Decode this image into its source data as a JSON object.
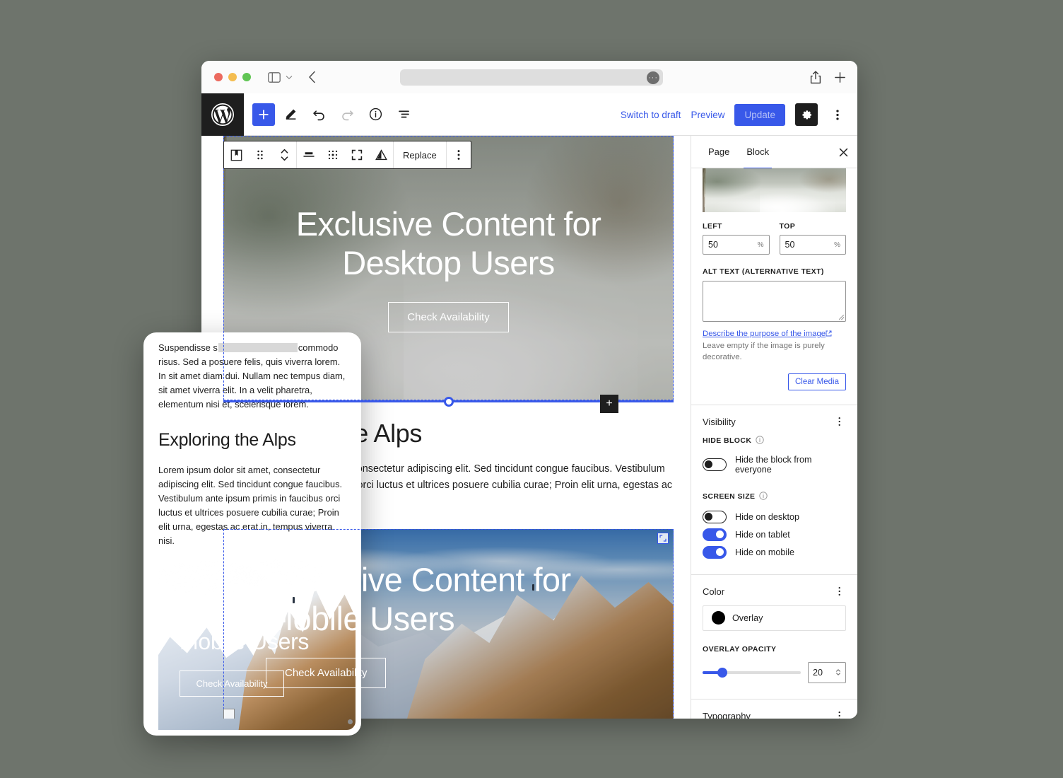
{
  "browser": {
    "traffic_lights": [
      "close",
      "minimize",
      "zoom"
    ],
    "url_value": "",
    "icons": [
      "sidebar-toggle-icon",
      "chevron-down-icon",
      "back-arrow-icon",
      "share-icon",
      "new-tab-icon"
    ]
  },
  "editor_header": {
    "logo": "wordpress-logo",
    "tools": [
      {
        "name": "add-block-button",
        "icon": "plus-icon"
      },
      {
        "name": "edit-tool-button",
        "icon": "pencil-icon"
      },
      {
        "name": "undo-button",
        "icon": "undo-arrow-icon"
      },
      {
        "name": "redo-button",
        "icon": "redo-arrow-icon"
      },
      {
        "name": "details-button",
        "icon": "info-circle-icon"
      },
      {
        "name": "list-view-button",
        "icon": "list-view-icon"
      }
    ],
    "switch_to_draft": "Switch to draft",
    "preview": "Preview",
    "update": "Update",
    "settings_icon": "gear-icon",
    "options_icon": "kebab-icon"
  },
  "block_toolbar": {
    "items": [
      {
        "name": "block-type-cover-icon",
        "label": ""
      },
      {
        "name": "drag-handle-icon",
        "label": ""
      },
      {
        "name": "move-up-down-icon",
        "label": ""
      },
      {
        "name": "align-icon",
        "label": ""
      },
      {
        "name": "content-position-icon",
        "label": ""
      },
      {
        "name": "full-height-icon",
        "label": ""
      },
      {
        "name": "duotone-filter-icon",
        "label": ""
      }
    ],
    "replace_label": "Replace",
    "more_options_icon": "kebab-icon"
  },
  "canvas": {
    "cover_one": {
      "title": "Exclusive Content for Desktop Users",
      "button_label": "Check Availability",
      "appender_label": "+"
    },
    "heading": "Exploring the Alps",
    "paragraph": "Lorem ipsum dolor sit amet, consectetur adipiscing elit. Sed tincidunt congue faucibus. Vestibulum ante ipsum primis in faucibus orci luctus et ultrices posuere cubilia curae; Proin elit urna, egestas ac erat in, tempus viverra nisi.",
    "cover_two": {
      "title": "Exclusive Content for Mobile Users",
      "button_label": "Check Availability"
    }
  },
  "inspector": {
    "tabs": [
      {
        "label": "Page",
        "active": false
      },
      {
        "label": "Block",
        "active": true
      }
    ],
    "close_icon": "close-icon",
    "focal_point": {
      "left_label": "LEFT",
      "left_value": "50",
      "left_unit": "%",
      "top_label": "TOP",
      "top_value": "50",
      "top_unit": "%"
    },
    "alt_text": {
      "label": "ALT TEXT (ALTERNATIVE TEXT)",
      "value": "",
      "help_link": "Describe the purpose of the image",
      "help_rest": "Leave empty if the image is purely decorative."
    },
    "clear_media": "Clear Media",
    "visibility": {
      "title": "Visibility",
      "hide_block_label": "HIDE BLOCK",
      "hide_everyone": {
        "label": "Hide the block from everyone",
        "on": false
      },
      "screen_size_label": "SCREEN SIZE",
      "screen_size_toggles": [
        {
          "label": "Hide on desktop",
          "on": false
        },
        {
          "label": "Hide on tablet",
          "on": true
        },
        {
          "label": "Hide on mobile",
          "on": true
        }
      ]
    },
    "color": {
      "title": "Color",
      "overlay_label": "Overlay",
      "overlay_swatch": "#000000",
      "opacity_label": "OVERLAY OPACITY",
      "opacity_value": "20",
      "opacity_percent": 20
    },
    "typography": {
      "title": "Typography"
    }
  },
  "mobile_preview": {
    "paragraph_before": "Suspendisse s",
    "paragraph_after": "commodo risus. Sed a posuere felis, quis viverra lorem. In sit amet diam dui. Nullam nec tempus diam, sit amet viverra elit. In a velit pharetra, elementum nisi et, scelerisque lorem.",
    "heading": "Exploring the Alps",
    "paragraph": "Lorem ipsum dolor sit amet, consectetur adipiscing elit. Sed tincidunt congue faucibus. Vestibulum ante ipsum primis in faucibus orci luctus et ultrices posuere cubilia curae; Proin elit urna, egestas ac erat in, tempus viverra nisi.",
    "cover_title": "Exclusive Content for Mobile Users",
    "cover_button": "Check Availability"
  },
  "colors": {
    "accent": "#3858e9",
    "dark": "#1e1e1e",
    "desktop_bg": "#6e746c"
  }
}
